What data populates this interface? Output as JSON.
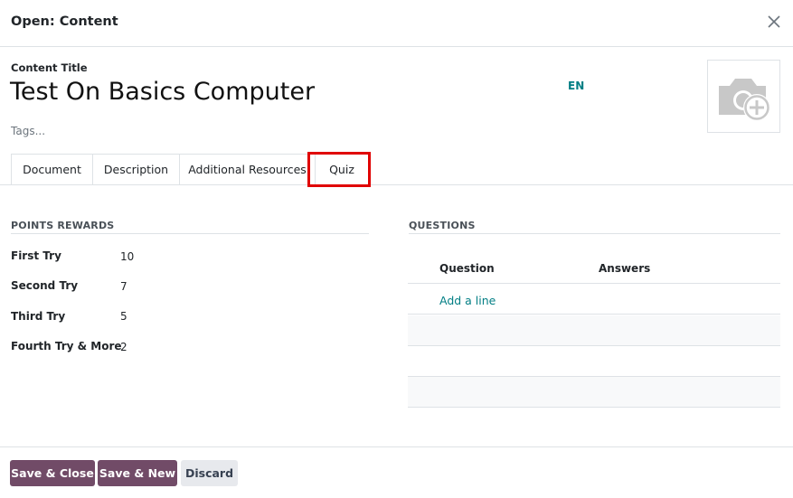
{
  "dialog": {
    "title": "Open: Content"
  },
  "form": {
    "content_title_label": "Content Title",
    "content_title_value": "Test On Basics Computer",
    "language": "EN",
    "tags_placeholder": "Tags..."
  },
  "tabs": [
    {
      "label": "Document"
    },
    {
      "label": "Description"
    },
    {
      "label": "Additional Resources"
    },
    {
      "label": "Quiz",
      "active": true
    }
  ],
  "points_rewards": {
    "title": "POINTS REWARDS",
    "rows": [
      {
        "label": "First Try",
        "value": "10"
      },
      {
        "label": "Second Try",
        "value": "7"
      },
      {
        "label": "Third Try",
        "value": "5"
      },
      {
        "label": "Fourth Try & More",
        "value": "2"
      }
    ]
  },
  "questions": {
    "title": "QUESTIONS",
    "col_question": "Question",
    "col_answers": "Answers",
    "add_line": "Add a line"
  },
  "footer": {
    "save_close": "Save & Close",
    "save_new": "Save & New",
    "discard": "Discard"
  },
  "colors": {
    "primary": "#714b67",
    "link": "#017e84",
    "highlight": "#e00000"
  },
  "icons": {
    "close": "close-icon",
    "image_placeholder": "camera-add-icon"
  }
}
